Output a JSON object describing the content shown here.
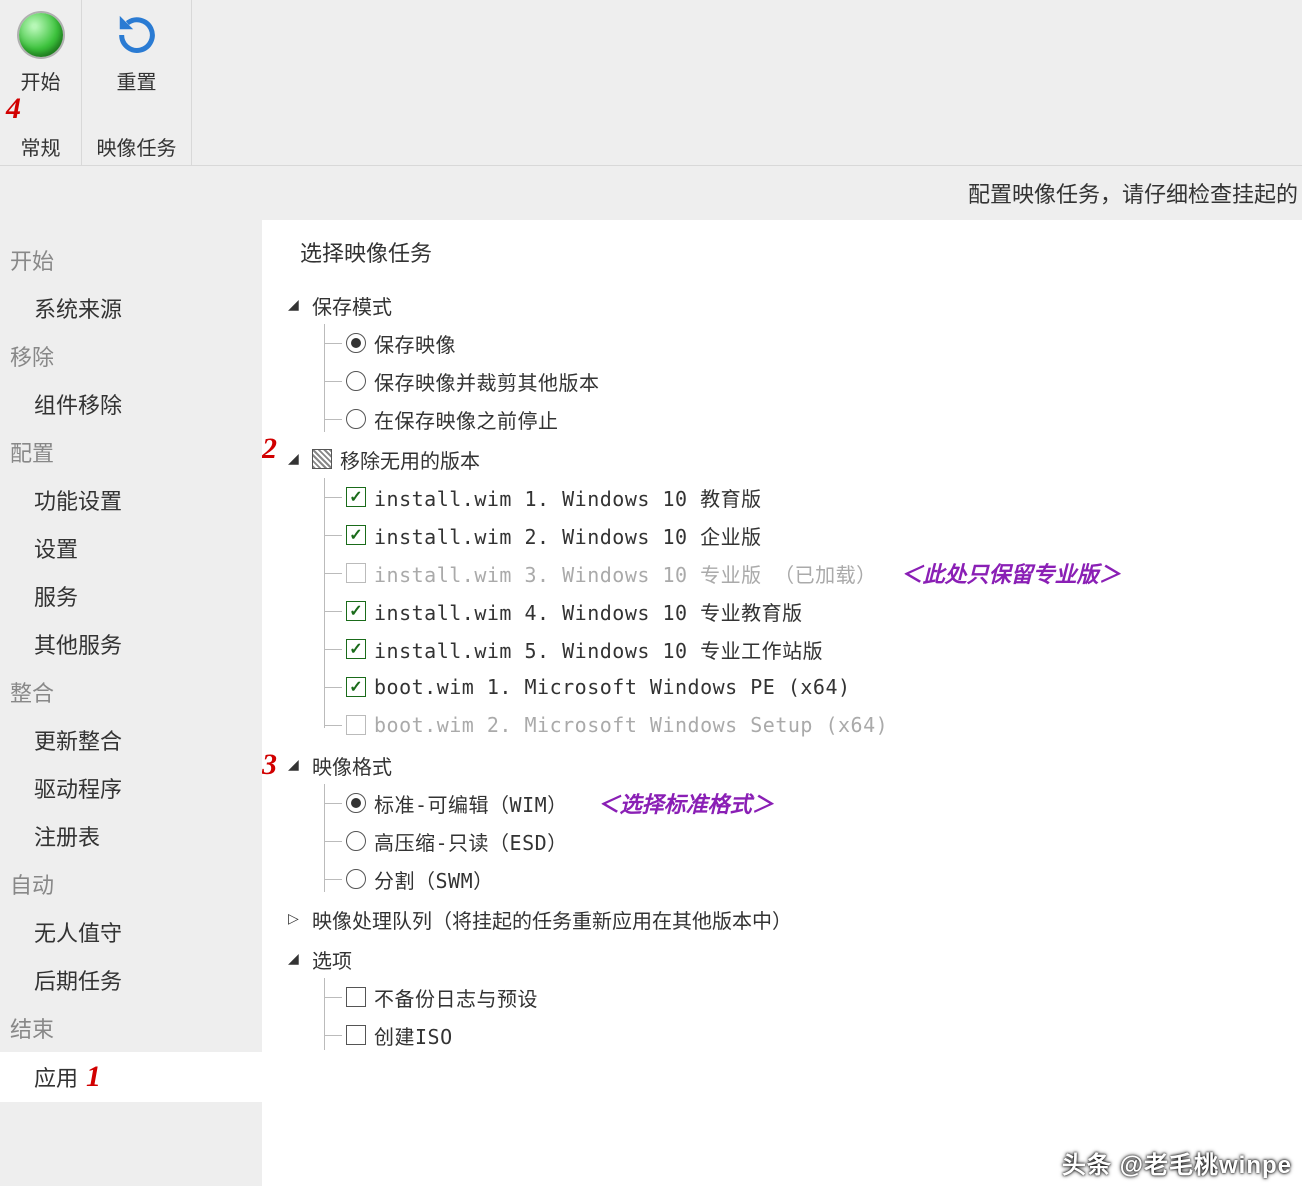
{
  "toolbar": {
    "start": {
      "label": "开始"
    },
    "reset": {
      "label": "重置"
    },
    "group_general": "常规",
    "group_image_tasks": "映像任务",
    "marker4": "4"
  },
  "hint": "配置映像任务，请仔细检查挂起的",
  "sidebar": {
    "sections": [
      {
        "head": "开始",
        "items": [
          "系统来源"
        ]
      },
      {
        "head": "移除",
        "items": [
          "组件移除"
        ]
      },
      {
        "head": "配置",
        "items": [
          "功能设置",
          "设置",
          "服务",
          "其他服务"
        ]
      },
      {
        "head": "整合",
        "items": [
          "更新整合",
          "驱动程序",
          "注册表"
        ]
      },
      {
        "head": "自动",
        "items": [
          "无人值守",
          "后期任务"
        ]
      },
      {
        "head": "结束",
        "items": [
          "应用"
        ]
      }
    ],
    "selected": "应用",
    "marker1": "1"
  },
  "main": {
    "title": "选择映像任务",
    "save_mode": {
      "label": "保存模式",
      "options": [
        {
          "label": "保存映像",
          "checked": true
        },
        {
          "label": "保存映像并裁剪其他版本",
          "checked": false
        },
        {
          "label": "在保存映像之前停止",
          "checked": false
        }
      ]
    },
    "remove_editions": {
      "label": "移除无用的版本",
      "marker": "2",
      "items": [
        {
          "label": "install.wim 1. Windows 10 教育版",
          "checked": true,
          "disabled": false
        },
        {
          "label": "install.wim 2. Windows 10 企业版",
          "checked": true,
          "disabled": false
        },
        {
          "label": "install.wim 3. Windows 10 专业版 （已加载）",
          "checked": false,
          "disabled": true
        },
        {
          "label": "install.wim 4. Windows 10 专业教育版",
          "checked": true,
          "disabled": false
        },
        {
          "label": "install.wim 5. Windows 10 专业工作站版",
          "checked": true,
          "disabled": false
        },
        {
          "label": "boot.wim 1. Microsoft Windows PE (x64)",
          "checked": true,
          "disabled": false
        },
        {
          "label": "boot.wim 2. Microsoft Windows Setup (x64)",
          "checked": false,
          "disabled": true
        }
      ],
      "annotation": "＜此处只保留专业版＞"
    },
    "image_format": {
      "label": "映像格式",
      "marker": "3",
      "options": [
        {
          "label": "标准-可编辑（WIM）",
          "checked": true
        },
        {
          "label": "高压缩-只读（ESD）",
          "checked": false
        },
        {
          "label": "分割（SWM）",
          "checked": false
        }
      ],
      "annotation": "＜选择标准格式＞"
    },
    "queue": {
      "label": "映像处理队列（将挂起的任务重新应用在其他版本中）"
    },
    "options": {
      "label": "选项",
      "items": [
        {
          "label": "不备份日志与预设",
          "checked": false
        },
        {
          "label": "创建ISO",
          "checked": false
        }
      ]
    }
  },
  "watermark": "头条 @老毛桃winpe"
}
